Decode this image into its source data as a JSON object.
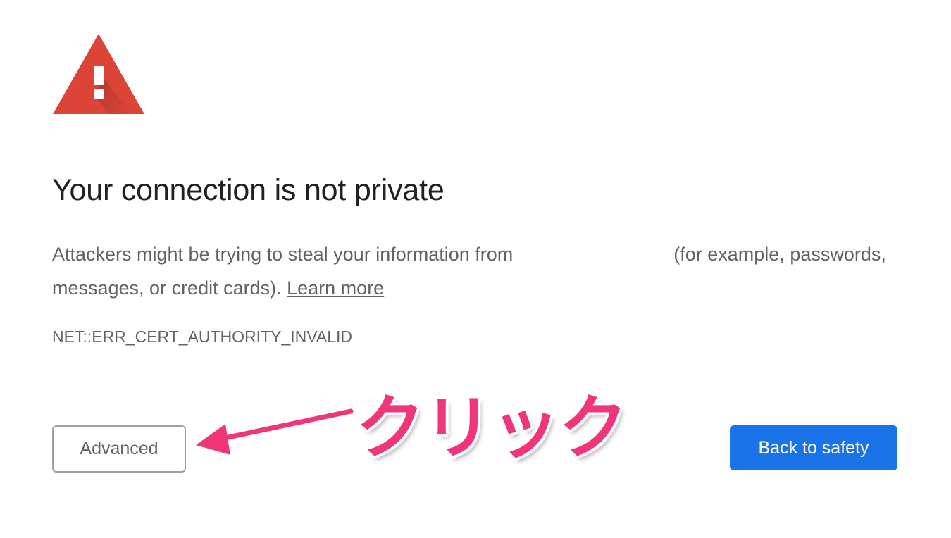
{
  "icons": {
    "warning": "warning-triangle-icon",
    "arrow": "arrow-left-icon"
  },
  "colors": {
    "warning_red": "#db4437",
    "primary_blue": "#1a73e8",
    "annotation_pink": "#f0357a",
    "text_gray": "#5f6368"
  },
  "page": {
    "title": "Your connection is not private",
    "description_part1": "Attackers might be trying to steal your information from",
    "description_part2": "(for example, passwords, messages, or credit cards).",
    "learn_more": "Learn more",
    "error_code": "NET::ERR_CERT_AUTHORITY_INVALID"
  },
  "buttons": {
    "advanced": "Advanced",
    "back_to_safety": "Back to safety"
  },
  "annotation": {
    "label": "クリック"
  }
}
